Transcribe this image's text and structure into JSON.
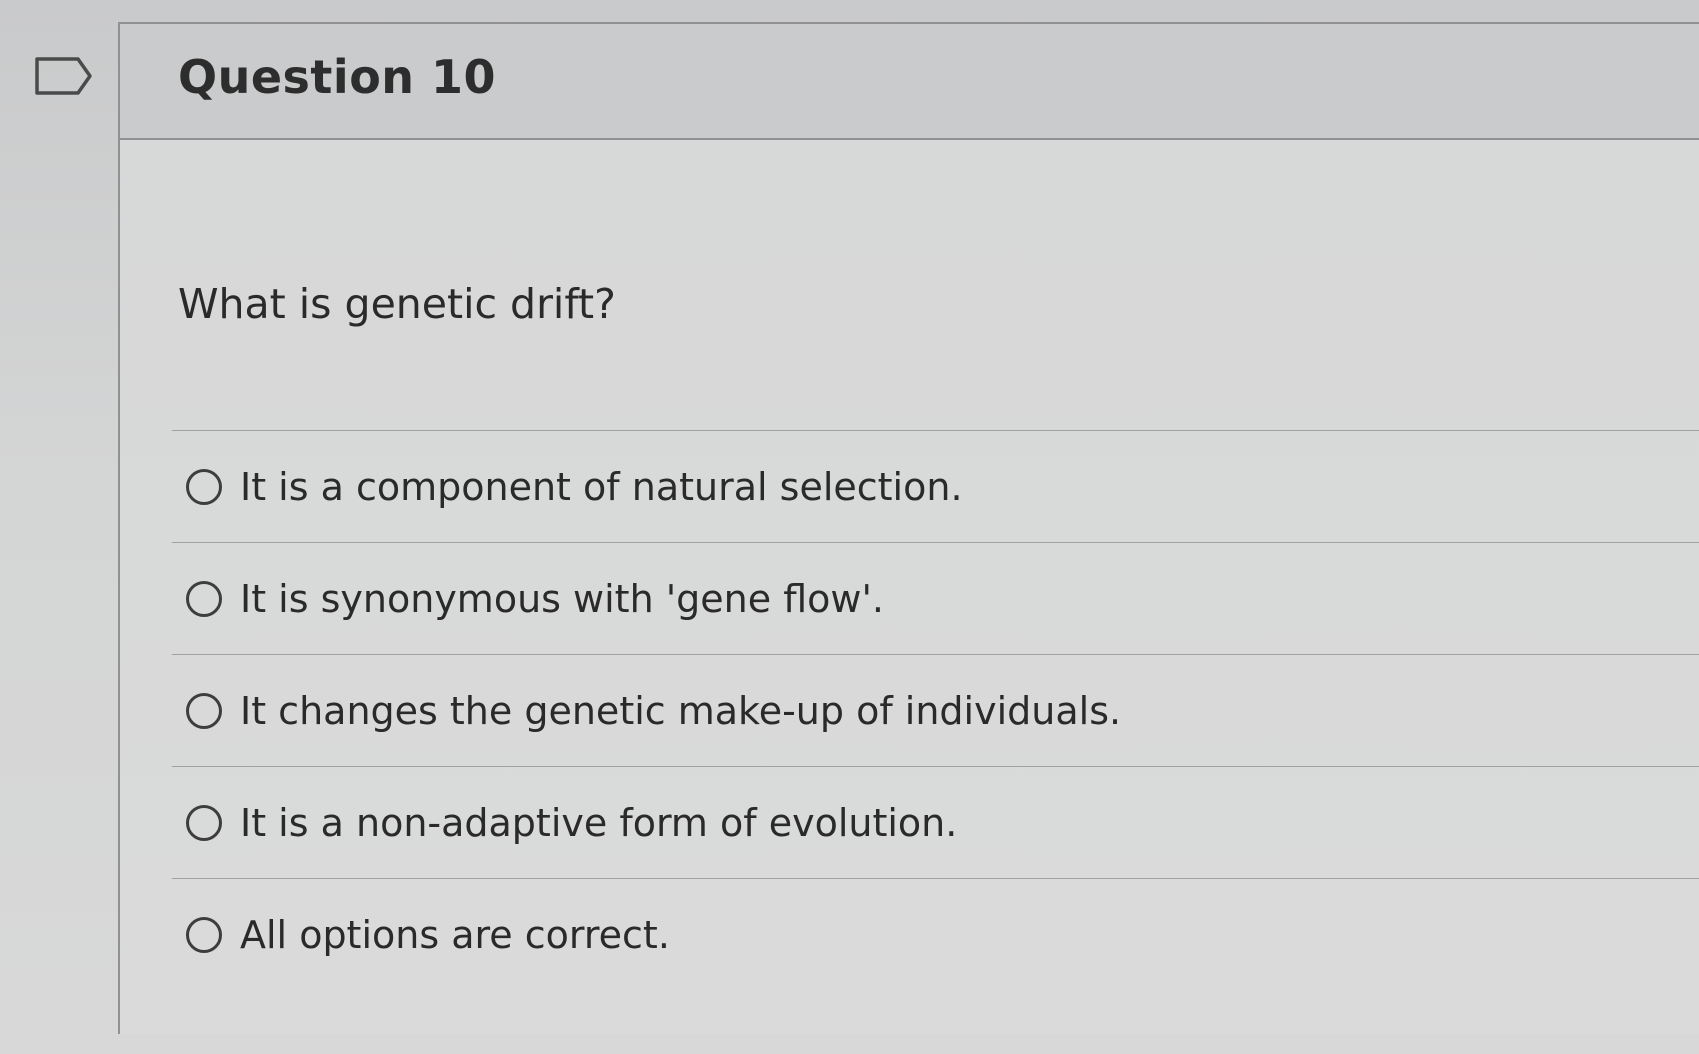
{
  "question": {
    "title": "Question 10",
    "text": "What is genetic drift?",
    "answers": [
      {
        "label": "It is a component of natural selection.",
        "selected": false
      },
      {
        "label": "It is synonymous with 'gene flow'.",
        "selected": false
      },
      {
        "label": "It changes the genetic make-up of individuals.",
        "selected": false
      },
      {
        "label": "It is a non-adaptive form of evolution.",
        "selected": false
      },
      {
        "label": "All options are correct.",
        "selected": false
      }
    ]
  },
  "icons": {
    "flag": "flag-icon",
    "radio": "radio-button-icon"
  }
}
